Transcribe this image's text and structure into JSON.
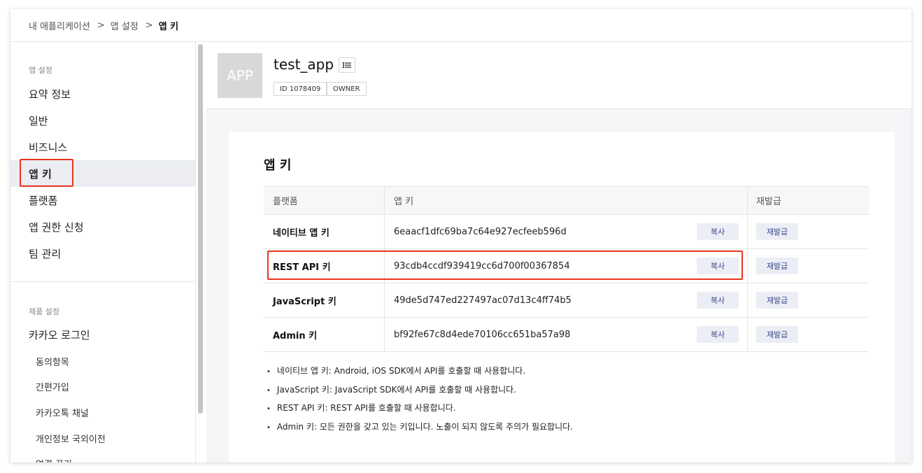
{
  "breadcrumb": {
    "items": [
      "내 애플리케이션",
      "앱 설정",
      "앱 키"
    ],
    "separator": ">"
  },
  "sidebar": {
    "app_settings_title": "앱 설정",
    "app_items": [
      {
        "label": "요약 정보",
        "active": false
      },
      {
        "label": "일반",
        "active": false
      },
      {
        "label": "비즈니스",
        "active": false
      },
      {
        "label": "앱 키",
        "active": true
      },
      {
        "label": "플랫폼",
        "active": false
      },
      {
        "label": "앱 권한 신청",
        "active": false
      },
      {
        "label": "팀 관리",
        "active": false
      }
    ],
    "product_settings_title": "제품 설정",
    "product_items": [
      {
        "label": "카카오 로그인",
        "level": 1
      },
      {
        "label": "동의항목",
        "level": 2
      },
      {
        "label": "간편가입",
        "level": 2
      },
      {
        "label": "카카오톡 채널",
        "level": 2
      },
      {
        "label": "개인정보 국외이전",
        "level": 2
      },
      {
        "label": "연결 끊기",
        "level": 2
      }
    ]
  },
  "app": {
    "thumb_text": "APP",
    "name": "test_app",
    "id_tag": "ID 1078409",
    "role_tag": "OWNER"
  },
  "section": {
    "title": "앱 키",
    "columns": [
      "플랫폼",
      "앱 키",
      "재발급"
    ],
    "rows": [
      {
        "platform": "네이티브 앱 키",
        "key": "6eaacf1dfc69ba7c64e927ecfeeb596d",
        "copy": "복사",
        "reissue": "재발급"
      },
      {
        "platform": "REST API 키",
        "key": "93cdb4ccdf939419cc6d700f00367854",
        "copy": "복사",
        "reissue": "재발급"
      },
      {
        "platform": "JavaScript 키",
        "key": "49de5d747ed227497ac07d13c4ff74b5",
        "copy": "복사",
        "reissue": "재발급"
      },
      {
        "platform": "Admin 키",
        "key": "bf92fe67c8d4ede70106cc651ba57a98",
        "copy": "복사",
        "reissue": "재발급"
      }
    ],
    "notes": [
      "네이티브 앱 키: Android, iOS SDK에서 API를 호출할 때 사용합니다.",
      "JavaScript 키: JavaScript SDK에서 API를 호출할 때 사용합니다.",
      "REST API 키: REST API를 호출할 때 사용합니다.",
      "Admin 키: 모든 권한을 갖고 있는 키입니다. 노출이 되지 않도록 주의가 필요합니다."
    ]
  },
  "colors": {
    "highlight": "#e8351f",
    "active_bg": "#ebedf3",
    "button_text": "#3a4a8c"
  },
  "icons": {
    "menu_button": "list-icon"
  }
}
